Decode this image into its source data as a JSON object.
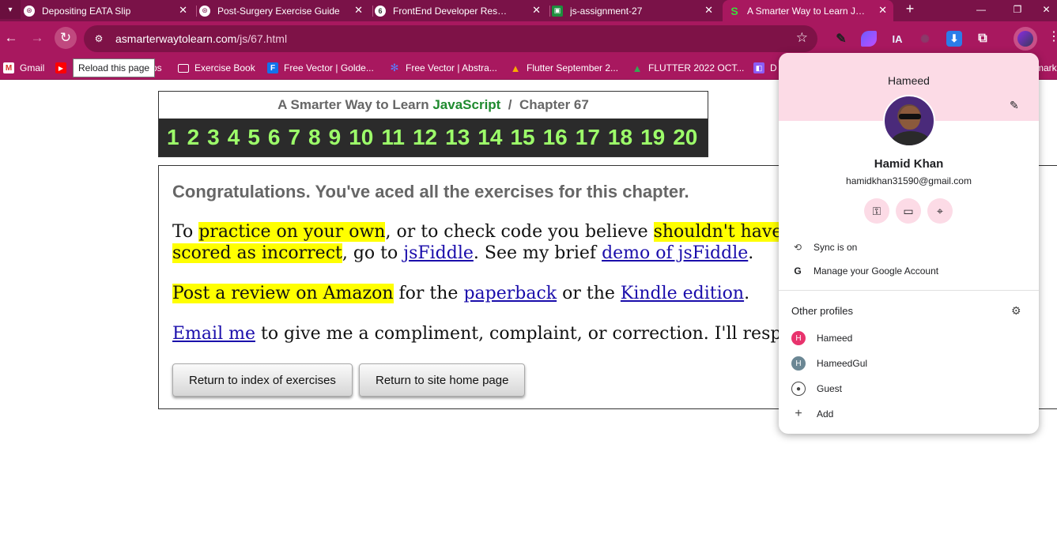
{
  "tabs": [
    {
      "title": "Depositing EATA Slip",
      "icon": "chatgpt-icon"
    },
    {
      "title": "Post-Surgery Exercise Guide",
      "icon": "chatgpt-icon"
    },
    {
      "title": "FrontEnd Developer Resume",
      "icon": "six-icon"
    },
    {
      "title": "js-assignment-27",
      "icon": "classroom-icon"
    },
    {
      "title": "A Smarter Way to Learn Java",
      "icon": "site-s-icon",
      "active": true
    }
  ],
  "toolbar": {
    "url_host": "asmarterwaytolearn.com",
    "url_path": "/js/67.html",
    "reload_tooltip": "Reload this page",
    "ext_ia": "IA"
  },
  "bookmarks": [
    {
      "label": "Gmail"
    },
    {
      "label": "ps"
    },
    {
      "label": "Exercise Book"
    },
    {
      "label": "Free Vector | Golde..."
    },
    {
      "label": "Free Vector | Abstra..."
    },
    {
      "label": "Flutter September 2..."
    },
    {
      "label": "FLUTTER 2022 OCT..."
    },
    {
      "label": "D"
    },
    {
      "label": "marks"
    }
  ],
  "page": {
    "header_prefix": "A Smarter Way to Learn ",
    "header_js": "JavaScript",
    "header_suffix": "  /  Chapter 67",
    "chapters": [
      "1",
      "2",
      "3",
      "4",
      "5",
      "6",
      "7",
      "8",
      "9",
      "10",
      "11",
      "12",
      "13",
      "14",
      "15",
      "16",
      "17",
      "18",
      "19",
      "20"
    ],
    "congrats": "Congratulations. You've aced all the exercises for this chapter.",
    "p1_a": "To ",
    "p1_hl1": "practice on your own",
    "p1_b": ", or to check code you believe ",
    "p1_hl2": "shouldn't have been",
    "p1_hl3": "scored as incorrect",
    "p1_c": ", go to ",
    "p1_link1": "jsFiddle",
    "p1_d": ". See my brief ",
    "p1_link2": "demo of jsFiddle",
    "p1_e": ".",
    "p2_hl": "Post a review on Amazon",
    "p2_a": " for the ",
    "p2_link1": "paperback",
    "p2_b": " or the ",
    "p2_link2": "Kindle edition",
    "p2_c": ".",
    "p3_link": "Email me",
    "p3_a": " to give me a compliment, complaint, or correction. I'll respond",
    "btn_index": "Return to index of exercises",
    "btn_home": "Return to site home page"
  },
  "profile": {
    "top_name": "Hameed",
    "full_name": "Hamid Khan",
    "email": "hamidkhan31590@gmail.com",
    "sync": "Sync is on",
    "manage": "Manage your Google Account",
    "other_profiles_heading": "Other profiles",
    "others": [
      {
        "initial": "H",
        "name": "Hameed",
        "color": "#e8336d"
      },
      {
        "initial": "H",
        "name": "HameedGul",
        "color": "#6b8794"
      },
      {
        "initial": "",
        "name": "Guest"
      },
      {
        "initial": "",
        "name": "Add"
      }
    ]
  },
  "colors": {
    "tab_strip": "#7a1248",
    "toolbar": "#a8185f",
    "popup_header": "#fcdbe6",
    "chapter_numbers": "#9dff6a",
    "highlight": "#ffff00",
    "link": "#1a0dab"
  }
}
